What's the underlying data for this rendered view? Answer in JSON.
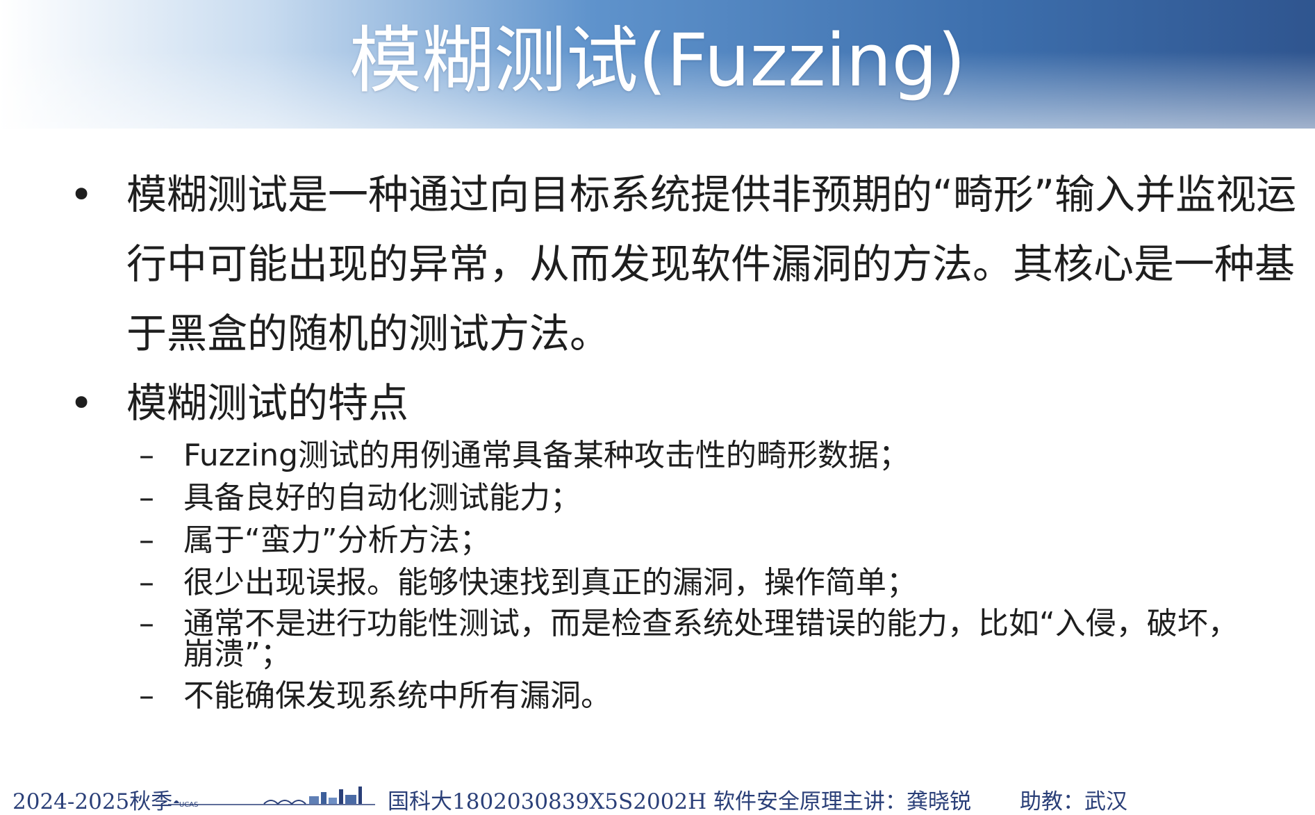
{
  "header": {
    "title": "模糊测试(Fuzzing)"
  },
  "content": {
    "bullets": [
      {
        "marker": "•",
        "text": "模糊测试是一种通过向目标系统提供非预期的“畸形”输入并监视运行中可能出现的异常，从而发现软件漏洞的方法。其核心是一种基于黑盒的随机的测试方法。"
      },
      {
        "marker": "•",
        "text": "模糊测试的特点"
      }
    ],
    "sub_items": [
      {
        "marker": "–",
        "text": "Fuzzing测试的用例通常具备某种攻击性的畸形数据；"
      },
      {
        "marker": "–",
        "text": "具备良好的自动化测试能力；"
      },
      {
        "marker": "–",
        "text": "属于“蛮力”分析方法；"
      },
      {
        "marker": "–",
        "text": "很少出现误报。能够快速找到真正的漏洞，操作简单；"
      },
      {
        "marker": "–",
        "text": "通常不是进行功能性测试，而是检查系统处理错误的能力，比如“入侵，破坏，崩溃”；"
      },
      {
        "marker": "–",
        "text": "不能确保发现系统中所有漏洞。"
      }
    ]
  },
  "footer": {
    "term": "2024-2025秋季",
    "logo_text": "UCAS",
    "course": "国科大1802030839X5S2002H 软件安全原理",
    "lecturer": "主讲：龚晓锐",
    "assistant": "助教：武汉"
  },
  "colors": {
    "title_text": "#ffffff",
    "title_gradient_start": "#ffffff",
    "title_gradient_end": "#2f558f",
    "body_text": "#1e1e1e",
    "footer_text": "#2a3f78"
  }
}
